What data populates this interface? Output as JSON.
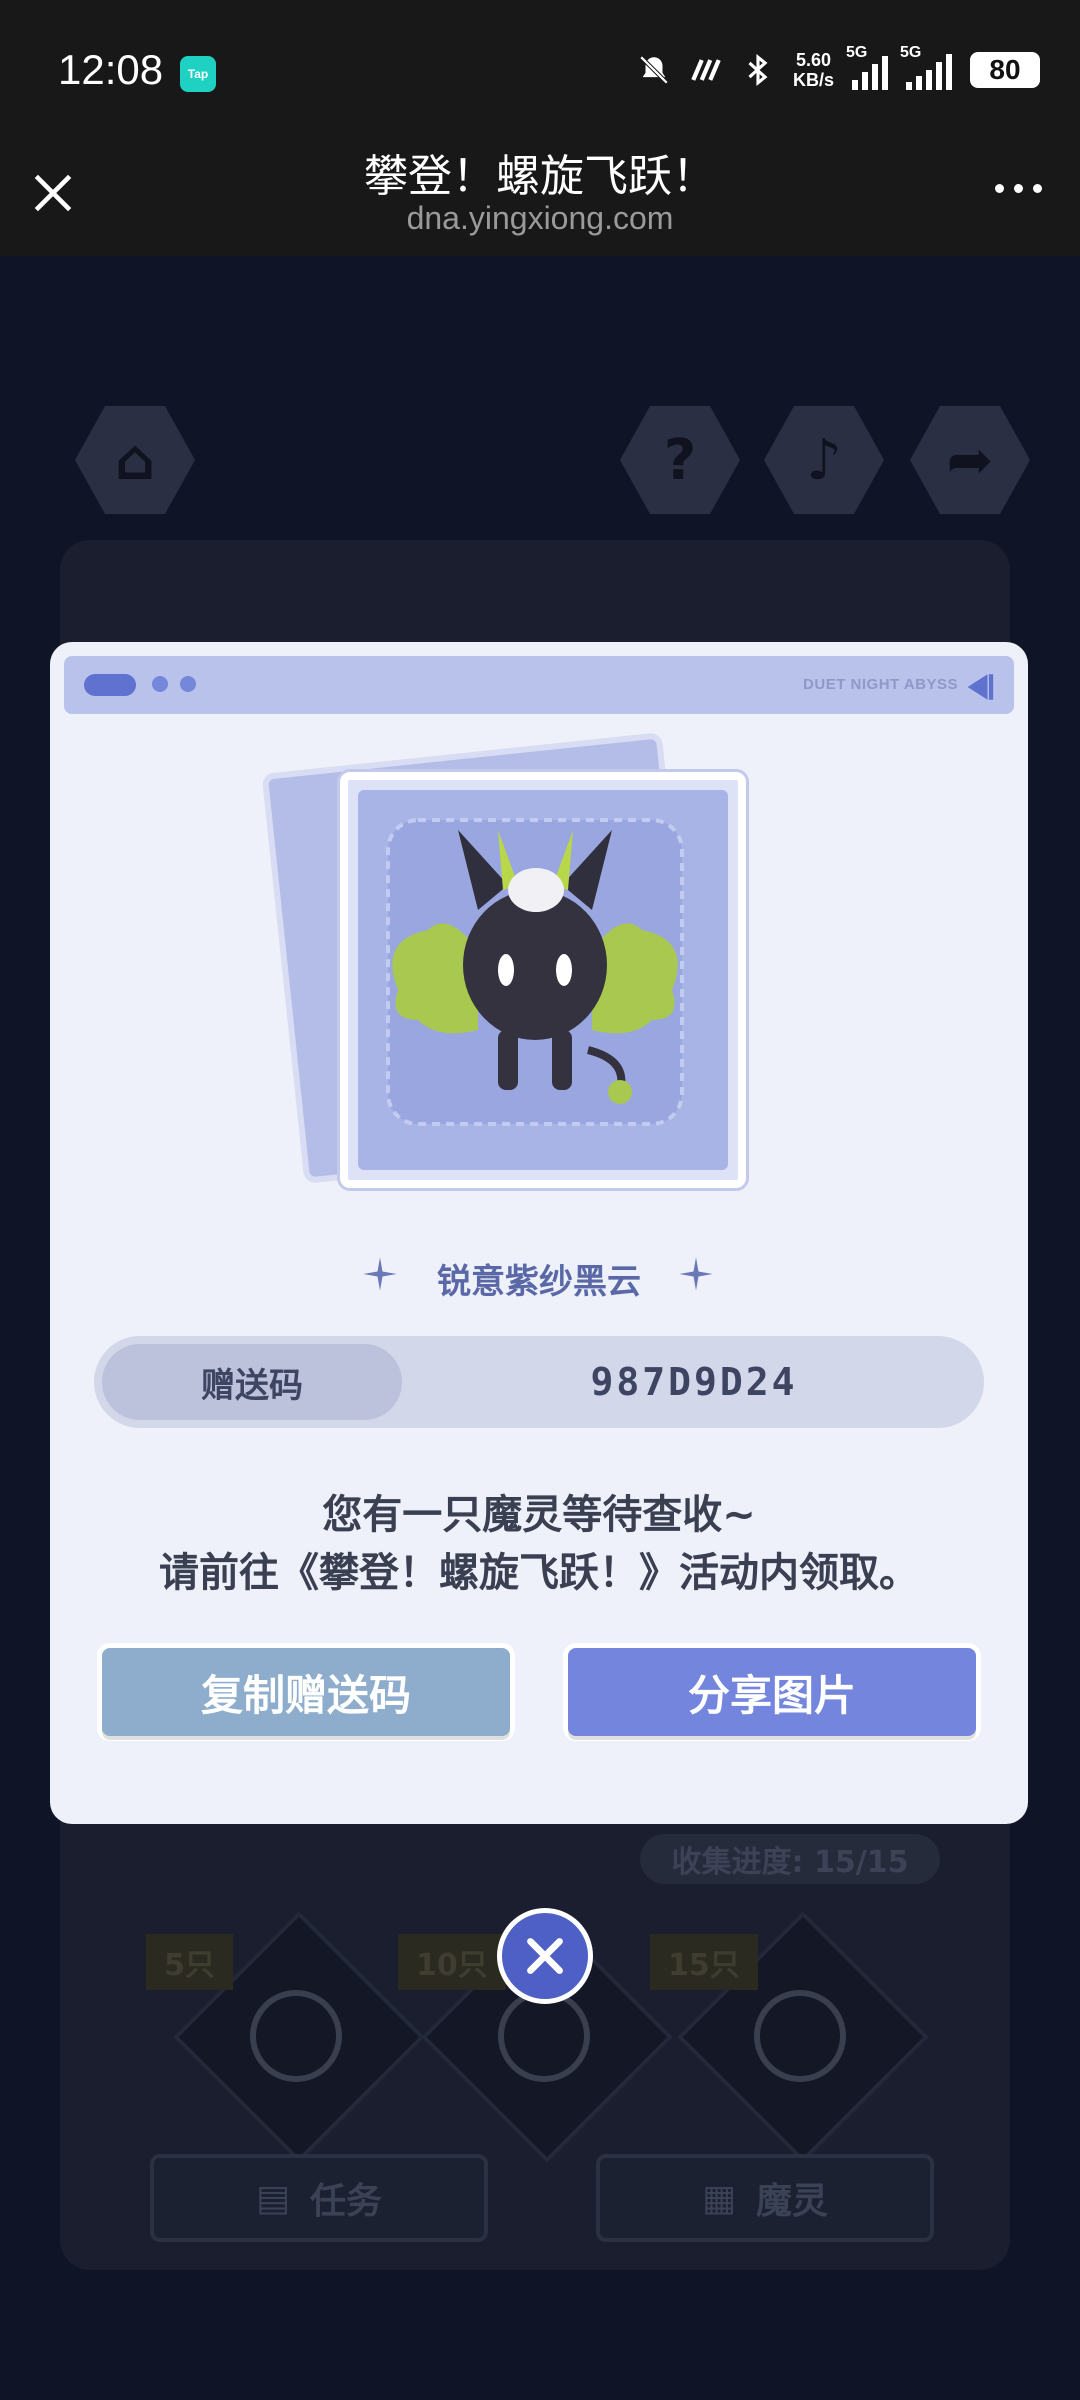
{
  "status_bar": {
    "time": "12:08",
    "app_badge": "Tap",
    "net_speed_value": "5.60",
    "net_speed_unit": "KB/s",
    "sim1": "5G",
    "sim2": "5G",
    "battery": "80"
  },
  "title_bar": {
    "title": "攀登！螺旋飞跃！",
    "url": "dna.yingxiong.com"
  },
  "background": {
    "progress_label": "收集进度: 15/15",
    "milestones": [
      "5只",
      "10只",
      "15只"
    ],
    "tab_task": "任务",
    "tab_pet": "魔灵"
  },
  "modal": {
    "header_text": "DUET NIGHT ABYSS",
    "pet_name": "锐意紫纱黑云",
    "code_label": "赠送码",
    "code_value": "987D9D24",
    "message_line1": "您有一只魔灵等待查收~",
    "message_line2": "请前往《攀登！螺旋飞跃！》活动内领取。",
    "copy_button": "复制赠送码",
    "share_button": "分享图片"
  },
  "colors": {
    "accent": "#7385dd",
    "copy_button": "#8eadcc",
    "modal_bg": "#eef1f9"
  }
}
